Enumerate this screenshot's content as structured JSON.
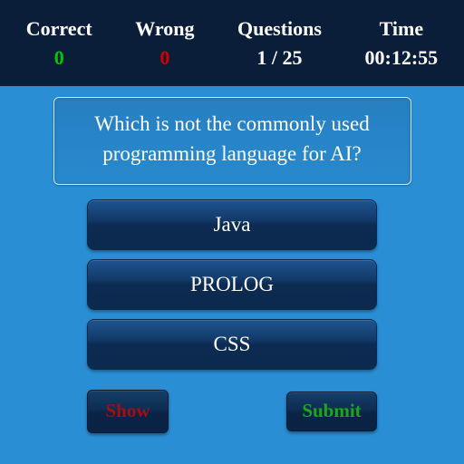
{
  "header": {
    "correct": {
      "label": "Correct",
      "value": "0"
    },
    "wrong": {
      "label": "Wrong",
      "value": "0"
    },
    "questions": {
      "label": "Questions",
      "value": "1 / 25"
    },
    "time": {
      "label": "Time",
      "value": "00:12:55"
    }
  },
  "question": "Which is not the commonly used programming language for AI?",
  "answers": [
    "Java",
    "PROLOG",
    "CSS"
  ],
  "buttons": {
    "show": "Show",
    "submit": "Submit"
  },
  "colors": {
    "header_bg": "#0a1e3a",
    "main_bg": "#2a8ed4",
    "correct": "#00c800",
    "wrong": "#d40000",
    "show": "#a01010",
    "submit": "#1aa81a"
  }
}
